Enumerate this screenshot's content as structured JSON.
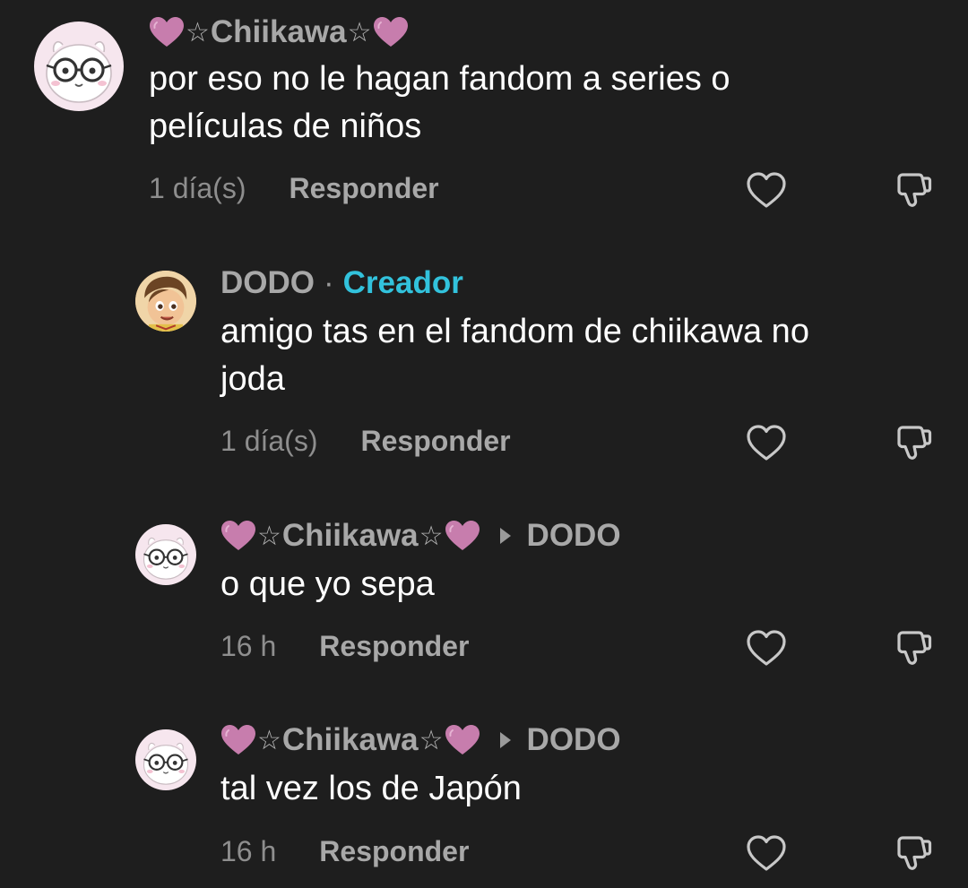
{
  "comments": [
    {
      "author_prefix_icon": "heart-icon",
      "author": "Chiikawa",
      "star": "☆",
      "author_suffix_icon": "heart-icon",
      "text_line1": "por eso no le hagan fandom a series o",
      "text_line2": "películas de niños",
      "time": "1 día(s)",
      "reply_label": "Responder"
    },
    {
      "author": "DODO",
      "separator": "·",
      "badge": "Creador",
      "text_line1": "amigo tas en el fandom de chiikawa no",
      "text_line2": "joda",
      "time": "1 día(s)",
      "reply_label": "Responder"
    },
    {
      "author": "Chiikawa",
      "star": "☆",
      "reply_to": "DODO",
      "text_line1": "o que yo sepa",
      "time": "16 h",
      "reply_label": "Responder"
    },
    {
      "author": "Chiikawa",
      "star": "☆",
      "reply_to": "DODO",
      "text_line1": "tal vez los de Japón",
      "time": "16 h",
      "reply_label": "Responder"
    }
  ],
  "colors": {
    "background": "#1e1e1e",
    "heart": "#c77dad",
    "creator_badge": "#32c2dc",
    "muted_text": "#8e8e8e",
    "action_text": "#a8a8a8"
  }
}
